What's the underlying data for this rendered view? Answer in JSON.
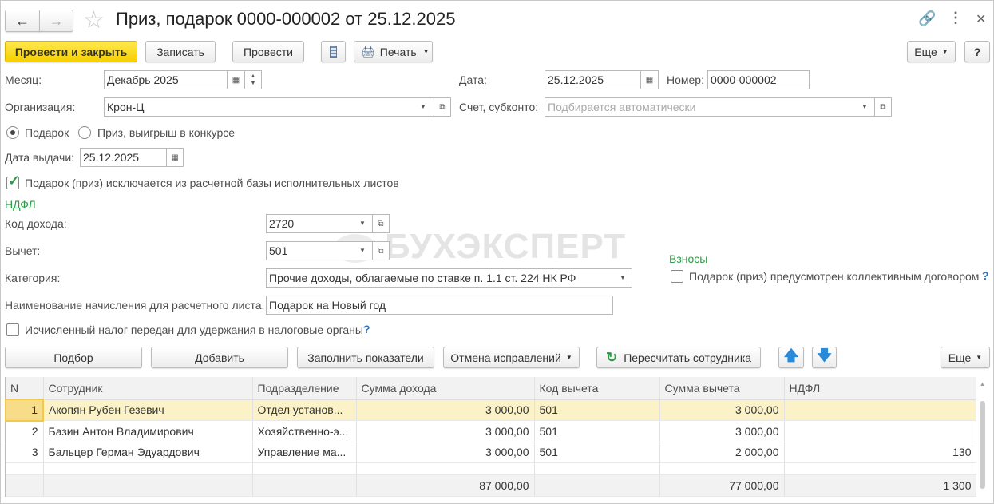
{
  "title": "Приз, подарок 0000-000002 от 25.12.2025",
  "watermark": "БУХЭКСПЕРТ",
  "toolbar": {
    "post_close": "Провести и закрыть",
    "save": "Записать",
    "post": "Провести",
    "print": "Печать",
    "more": "Еще",
    "help": "?"
  },
  "fields": {
    "month_label": "Месяц:",
    "month": "Декабрь 2025",
    "date_label": "Дата:",
    "date": "25.12.2025",
    "number_label": "Номер:",
    "number": "0000-000002",
    "org_label": "Организация:",
    "org": "Крон-Ц",
    "account_label": "Счет, субконто:",
    "account_placeholder": "Подбирается автоматически",
    "radio_gift": "Подарок",
    "radio_prize": "Приз, выигрыш в конкурсе",
    "issue_date_label": "Дата выдачи:",
    "issue_date": "25.12.2025",
    "exclude_label": "Подарок (приз) исключается из расчетной базы исполнительных листов",
    "ndfl_section": "НДФЛ",
    "income_code_label": "Код дохода:",
    "income_code": "2720",
    "deduction_label": "Вычет:",
    "deduction": "501",
    "category_label": "Категория:",
    "category": "Прочие доходы, облагаемые по ставке п. 1.1 ст. 224 НК РФ",
    "accrual_name_label": "Наименование начисления для расчетного листа:",
    "accrual_name": "Подарок на Новый год",
    "tax_transferred_label": "Исчисленный налог передан для удержания в налоговые органы",
    "contrib_section": "Взносы",
    "collective_label": "Подарок (приз) предусмотрен коллективным договором",
    "q": "?"
  },
  "table_toolbar": {
    "pick": "Подбор",
    "add": "Добавить",
    "fill": "Заполнить показатели",
    "cancel_fix": "Отмена исправлений",
    "recalc": "Пересчитать сотрудника",
    "more": "Еще"
  },
  "table": {
    "headers": [
      "N",
      "Сотрудник",
      "Подразделение",
      "Сумма дохода",
      "Код вычета",
      "Сумма вычета",
      "НДФЛ"
    ],
    "rows": [
      [
        "1",
        "Акопян Рубен Гезевич",
        "Отдел установ...",
        "3 000,00",
        "501",
        "3 000,00",
        ""
      ],
      [
        "2",
        "Базин Антон Владимирович",
        "Хозяйственно-э...",
        "3 000,00",
        "501",
        "3 000,00",
        ""
      ],
      [
        "3",
        "Бальцер Герман Эдуардович",
        "Управление ма...",
        "3 000,00",
        "501",
        "2 000,00",
        "130"
      ]
    ],
    "totals": {
      "income": "87 000,00",
      "deduction": "77 000,00",
      "ndfl": "1 300"
    }
  }
}
